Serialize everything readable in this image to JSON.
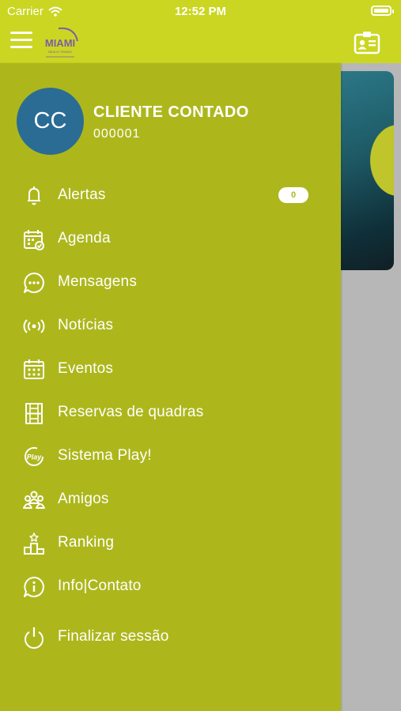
{
  "status_bar": {
    "carrier": "Carrier",
    "time": "12:52 PM"
  },
  "header": {
    "logo_text": "MIAMI",
    "logo_subtext": "BEACH TENNIS"
  },
  "user": {
    "initials": "CC",
    "name": "CLIENTE CONTADO",
    "code": "000001"
  },
  "menu": {
    "items": [
      {
        "label": "Alertas",
        "icon": "bell-icon",
        "badge": "0"
      },
      {
        "label": "Agenda",
        "icon": "calendar-check-icon"
      },
      {
        "label": "Mensagens",
        "icon": "chat-bubble-icon"
      },
      {
        "label": "Notícias",
        "icon": "broadcast-icon"
      },
      {
        "label": "Eventos",
        "icon": "calendar-grid-icon"
      },
      {
        "label": "Reservas de quadras",
        "icon": "court-icon"
      },
      {
        "label": "Sistema Play!",
        "icon": "play-icon"
      },
      {
        "label": "Amigos",
        "icon": "people-icon"
      },
      {
        "label": "Ranking",
        "icon": "podium-icon"
      },
      {
        "label": "Info|Contato",
        "icon": "info-icon"
      },
      {
        "label": "Finalizar sessão",
        "icon": "power-icon"
      }
    ]
  },
  "colors": {
    "header": "#cbd622",
    "drawer": "#adb71c",
    "avatar": "#2b6c95"
  }
}
